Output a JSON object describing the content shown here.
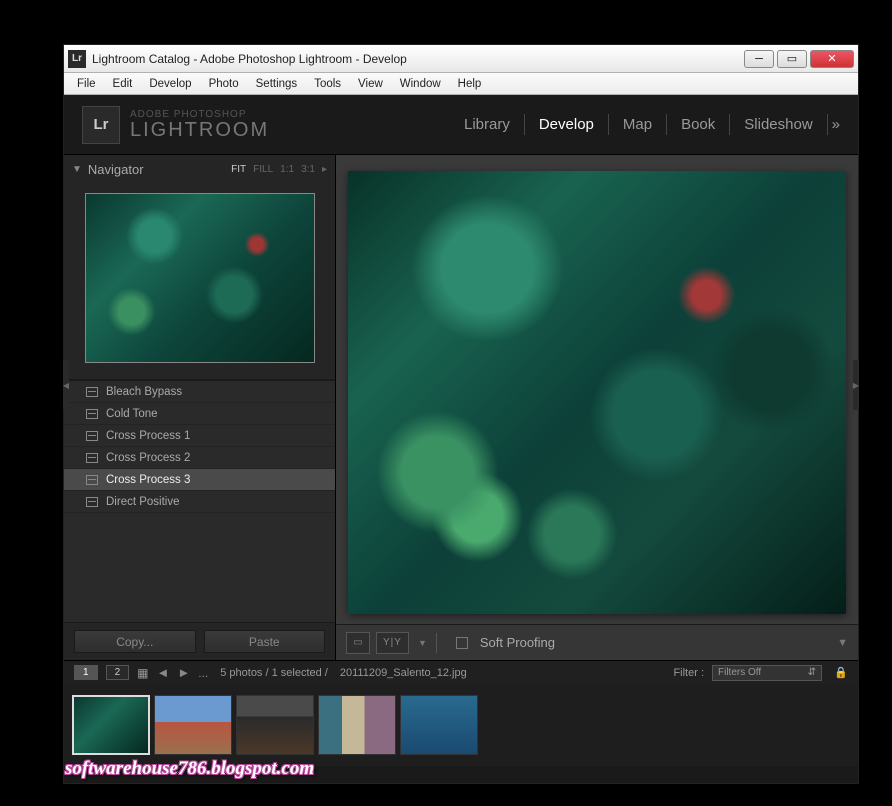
{
  "titlebar": {
    "icon": "Lr",
    "title": "Lightroom   Catalog - Adobe Photoshop Lightroom - Develop"
  },
  "menubar": [
    "File",
    "Edit",
    "Develop",
    "Photo",
    "Settings",
    "Tools",
    "View",
    "Window",
    "Help"
  ],
  "brand": {
    "icon": "Lr",
    "line1": "ADOBE PHOTOSHOP",
    "line2": "LIGHTROOM"
  },
  "modules": {
    "items": [
      "Library",
      "Develop",
      "Map",
      "Book",
      "Slideshow"
    ],
    "active": "Develop",
    "more": "»"
  },
  "navigator": {
    "title": "Navigator",
    "zoom": [
      "FIT",
      "FILL",
      "1:1",
      "3:1"
    ],
    "zoom_active": "FIT",
    "zoom_more": "▸"
  },
  "presets": {
    "items": [
      "Bleach Bypass",
      "Cold Tone",
      "Cross Process 1",
      "Cross Process 2",
      "Cross Process 3",
      "Direct Positive"
    ],
    "selected": "Cross Process 3"
  },
  "copypaste": {
    "copy": "Copy...",
    "paste": "Paste"
  },
  "toolbar": {
    "yy": "Y|Y",
    "proof": "Soft Proofing"
  },
  "filmstrip": {
    "badge1": "1",
    "badge2": "2",
    "info_count": "5 photos / 1 selected /",
    "info_file": "20111209_Salento_12.jpg",
    "filter_label": "Filter :",
    "filter_value": "Filters Off"
  },
  "watermark": "softwarehouse786.blogspot.com"
}
